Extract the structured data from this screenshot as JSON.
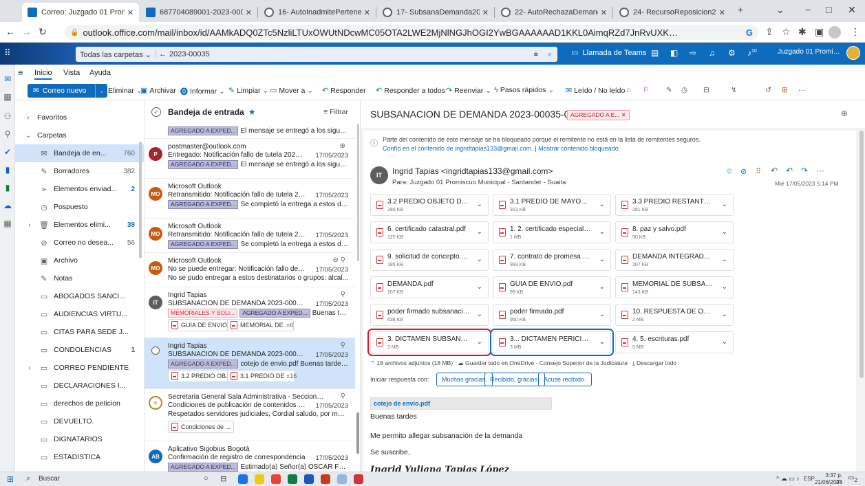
{
  "browser": {
    "tabs": [
      {
        "title": "Correo: Juzgado 01 Promis",
        "active": true
      },
      {
        "title": "687704089001-2023-0003",
        "active": false
      },
      {
        "title": "16- AutoInadmitePertenen",
        "active": false
      },
      {
        "title": "17- SubsanaDemanda2023",
        "active": false
      },
      {
        "title": "22- AutoRechazaDemanda",
        "active": false
      },
      {
        "title": "24- RecursoReposicion202",
        "active": false
      }
    ],
    "url": "outlook.office.com/mail/inbox/id/AAMkADQ0ZTc5NzliLTUxOWUtNDcwMC05OTA2LWE2MjNlNGJhOGI2YwBGAAAAAAD1KKL0AimqRZd7JnRvUXKoBwDd2jqt2v18SLDvr...",
    "new_tab_icon": "+",
    "minimize": "−",
    "maximize": "□",
    "close": "✕",
    "profile_letter": "G"
  },
  "outlook": {
    "search_scope": "Todas las carpetas",
    "search_value": "2023-00035",
    "teams_label": "Llamada de Teams",
    "notif_count": "10",
    "account_name": "Juzgado 01 Promiscuo ..."
  },
  "ribbon": {
    "tabs": [
      "Inicio",
      "Vista",
      "Ayuda"
    ],
    "new_mail": "Correo nuevo",
    "actions": [
      {
        "label": "Eliminar",
        "icon": "🗑"
      },
      {
        "label": "Archivar",
        "icon": "▣"
      },
      {
        "label": "Informar",
        "icon": "⓿"
      },
      {
        "label": "Limpiar",
        "icon": "✎"
      },
      {
        "label": "Mover a",
        "icon": "▭"
      },
      {
        "label": "Responder",
        "icon": "↶"
      },
      {
        "label": "Responder a todos",
        "icon": "↶"
      },
      {
        "label": "Reenviar",
        "icon": "↷"
      },
      {
        "label": "Pasos rápidos",
        "icon": "ϟ"
      },
      {
        "label": "Leído / No leído",
        "icon": "✉"
      }
    ],
    "more": "···"
  },
  "folders": [
    {
      "name": "Favoritos",
      "chevron": "›",
      "icon": "",
      "count": "",
      "bold": false
    },
    {
      "name": "Carpetas",
      "chevron": "⌄",
      "icon": "",
      "count": "",
      "bold": false
    },
    {
      "name": "Bandeja de en...",
      "chevron": "",
      "icon": "✉",
      "count": "760",
      "bold": false,
      "selected": true
    },
    {
      "name": "Borradores",
      "chevron": "",
      "icon": "✎",
      "count": "382",
      "bold": false
    },
    {
      "name": "Elementos enviad...",
      "chevron": "",
      "icon": "➢",
      "count": "2",
      "bold": false,
      "blue": true
    },
    {
      "name": "Pospuesto",
      "chevron": "",
      "icon": "◷",
      "count": "",
      "bold": false
    },
    {
      "name": "Elementos elimi...",
      "chevron": "›",
      "icon": "🗑",
      "count": "39",
      "bold": false,
      "blue": true
    },
    {
      "name": "Correo no desea...",
      "chevron": "",
      "icon": "⊘",
      "count": "56",
      "bold": false
    },
    {
      "name": "Archivo",
      "chevron": "",
      "icon": "▣",
      "count": "",
      "bold": false
    },
    {
      "name": "Notas",
      "chevron": "",
      "icon": "✎",
      "count": "",
      "bold": false
    },
    {
      "name": "ABOGADOS SANCI...",
      "chevron": "",
      "icon": "▭",
      "count": "",
      "bold": false
    },
    {
      "name": "AUDIENCIAS VIRTU...",
      "chevron": "",
      "icon": "▭",
      "count": "",
      "bold": false
    },
    {
      "name": "CITAS PARA SEDE J...",
      "chevron": "",
      "icon": "▭",
      "count": "",
      "bold": false
    },
    {
      "name": "CONDOLENCIAS",
      "chevron": "",
      "icon": "▭",
      "count": "1",
      "bold": false,
      "blue": true
    },
    {
      "name": "CORREO PENDIENTE",
      "chevron": "›",
      "icon": "▭",
      "count": "",
      "bold": false
    },
    {
      "name": "DECLARACIONES I...",
      "chevron": "",
      "icon": "▭",
      "count": "",
      "bold": false
    },
    {
      "name": "derechos de peticion",
      "chevron": "",
      "icon": "▭",
      "count": "",
      "bold": false
    },
    {
      "name": "DEVUELTO.",
      "chevron": "",
      "icon": "▭",
      "count": "",
      "bold": false
    },
    {
      "name": "DIGNATARIOS",
      "chevron": "",
      "icon": "▭",
      "count": "",
      "bold": false
    },
    {
      "name": "ESTADISTICA",
      "chevron": "",
      "icon": "▭",
      "count": "",
      "bold": false
    }
  ],
  "list": {
    "title": "Bandeja de entrada",
    "filter": "Filtrar",
    "top_tag": "AGREGADO A EXPED...",
    "top_preview": "El mensaje se entregó a los siguient...",
    "messages": [
      {
        "sender": "postmaster@outlook.com",
        "subject": "Entregado: Notificación fallo de tutela 2023-0...",
        "date": "17/05/2023",
        "tag": "AGREGADO A EXPED...",
        "preview": "El mensaje se entregó a los siguient...",
        "initials": "P",
        "color": "#a4262c"
      },
      {
        "sender": "Microsoft Outlook",
        "subject": "Retransmitido: Notificación fallo de tutela 20...",
        "date": "17/05/2023",
        "tag": "AGREGADO A EXPED...",
        "preview": "Se completó la entrega a estos desti...",
        "initials": "MO",
        "color": "#c75b12"
      },
      {
        "sender": "Microsoft Outlook",
        "subject": "Retransmitido: Notificación fallo de tutela 20...",
        "date": "17/05/2023",
        "tag": "AGREGADO A EXPED...",
        "preview": "Se completó la entrega a estos desti...",
        "initials": "MO",
        "color": "#c75b12"
      },
      {
        "sender": "Microsoft Outlook",
        "subject": "No se puede entregar: Notificación fallo de t...",
        "date": "17/05/2023",
        "preview": "No se pudo entregar a estos destinatarios o grupos: alcal...",
        "initials": "MO",
        "color": "#c75b12"
      },
      {
        "sender": "Ingrid Tapias",
        "subject": "SUBSANACION DE DEMANDA 2023-00035-00",
        "date": "17/05/2023",
        "tag_red": "MEMORIALES Y SOLI...",
        "tag": "AGREGADO A EXPED...",
        "preview": "Buenas tardes ...",
        "initials": "IT",
        "color": "#605e5c",
        "chips": [
          "GUIA DE ENVIO...",
          "MEMORIAL DE ...",
          "+6"
        ]
      },
      {
        "sender": "Ingrid Tapias",
        "subject": "SUBSANACION DE DEMANDA 2023-00035-00",
        "date": "17/05/2023",
        "tag": "AGREGADO A EXPED...",
        "preview": "cotejo de envio.pdf Buenas tardes ...",
        "chips": [
          "3.2 PREDIO OBJ...",
          "3.1 PREDIO DE ...",
          "+16"
        ]
      },
      {
        "sender": "Secretaria General Sala Administrativa - Seccional B...",
        "subject": "Condiciones de publicación de contenidos en...",
        "date": "17/05/2023",
        "preview": "Respetados servidores judiciales, Cordial saludo, por medi...",
        "chips": [
          "Condiciones de ..."
        ]
      },
      {
        "sender": "Aplicativo Sigobius Bogotá",
        "subject": "Confirmación de registro de correspondencia",
        "date": "17/05/2023",
        "tag": "AGREGADO A EXPED...",
        "preview": "Estimado(a) Señor(a) OSCAR FERNA...",
        "initials": "AB",
        "color": "#0f6cbd"
      }
    ]
  },
  "reading": {
    "subject": "SUBSANACION DE DEMANDA 2023-00035-00",
    "subject_tag": "AGREGADO A E...",
    "blocked_notice": "Parte del contenido de este mensaje se ha bloqueado porque el remitente no está en la lista de remitentes seguros.",
    "trust_link": "Confío en el contenido de ingridtapias133@gmail.com.",
    "show_blocked": "Mostrar contenido bloqueado",
    "from": "Ingrid Tapias <ingridtapias133@gmail.com>",
    "to": "Para: Juzgado 01 Promiscuo Municipal - Santander - Suaita",
    "datetime": "Mié 17/05/2023 5:14 PM",
    "sender_initials": "IT",
    "attachments": [
      {
        "name": "3.2 PREDIO OBJETO DE PERT...",
        "size": "280 KB"
      },
      {
        "name": "3.1 PREDIO DE MAYOR EXTE...",
        "size": "313 KB"
      },
      {
        "name": "3.3 PREDIO RESTANTE MAYO...",
        "size": "281 KB"
      },
      {
        "name": "6. certificado catastral.pdf",
        "size": "125 KB"
      },
      {
        "name": "1. 2. certificado especial y lib...",
        "size": "1 MB"
      },
      {
        "name": "8. paz y salvo.pdf",
        "size": "50 KB"
      },
      {
        "name": "9. solicitud de concepto.pdf",
        "size": "185 KB"
      },
      {
        "name": "7. contrato de promesa de c...",
        "size": "993 KB"
      },
      {
        "name": "DEMANDA INTEGRADA.pdf",
        "size": "207 KB"
      },
      {
        "name": "DEMANDA.pdf",
        "size": "207 KB"
      },
      {
        "name": "GUIA DE ENVIO.pdf",
        "size": "99 KB"
      },
      {
        "name": "MEMORIAL DE SUBSANACIO...",
        "size": "143 KB"
      },
      {
        "name": "poder firmado subsanacion.p...",
        "size": "638 KB"
      },
      {
        "name": "poder firmado.pdf",
        "size": "950 KB"
      },
      {
        "name": "10. RESPUESTA DE ORIP DEL ...",
        "size": "2 MB"
      },
      {
        "name": "3. DICTAMEN SUBSANACION...",
        "size": "3 MB",
        "highlight": "#e81123"
      },
      {
        "name": "3... DICTAMEN PERICIAL PRO...",
        "size": "3 MB",
        "highlight": "#0f6cbd"
      },
      {
        "name": "4. 5. escrituras.pdf",
        "size": "5 MB"
      }
    ],
    "attach_summary": "18 archivos adjuntos (18 MB)",
    "save_onedrive": "Guardar todo en OneDrive - Consejo Superior de la Judicatura",
    "download_all": "Descargar todo",
    "quick_reply_label": "Iniciar respuesta con:",
    "quick_replies": [
      "Muchas gracias.",
      "Recibido, gracias.",
      "Acuse recibido."
    ],
    "inline_file": "cotejo de envio.pdf",
    "body": [
      "Buenas tardes",
      "Me permito allegar subsanación de la demanda",
      "Se suscribe,"
    ],
    "signature": "Ingrid Yuliana Tapias López"
  },
  "taskbar": {
    "search": "Buscar",
    "lang": "ESP",
    "time": "3:37 p. m.",
    "date": "21/06/2023",
    "notif": "2"
  }
}
